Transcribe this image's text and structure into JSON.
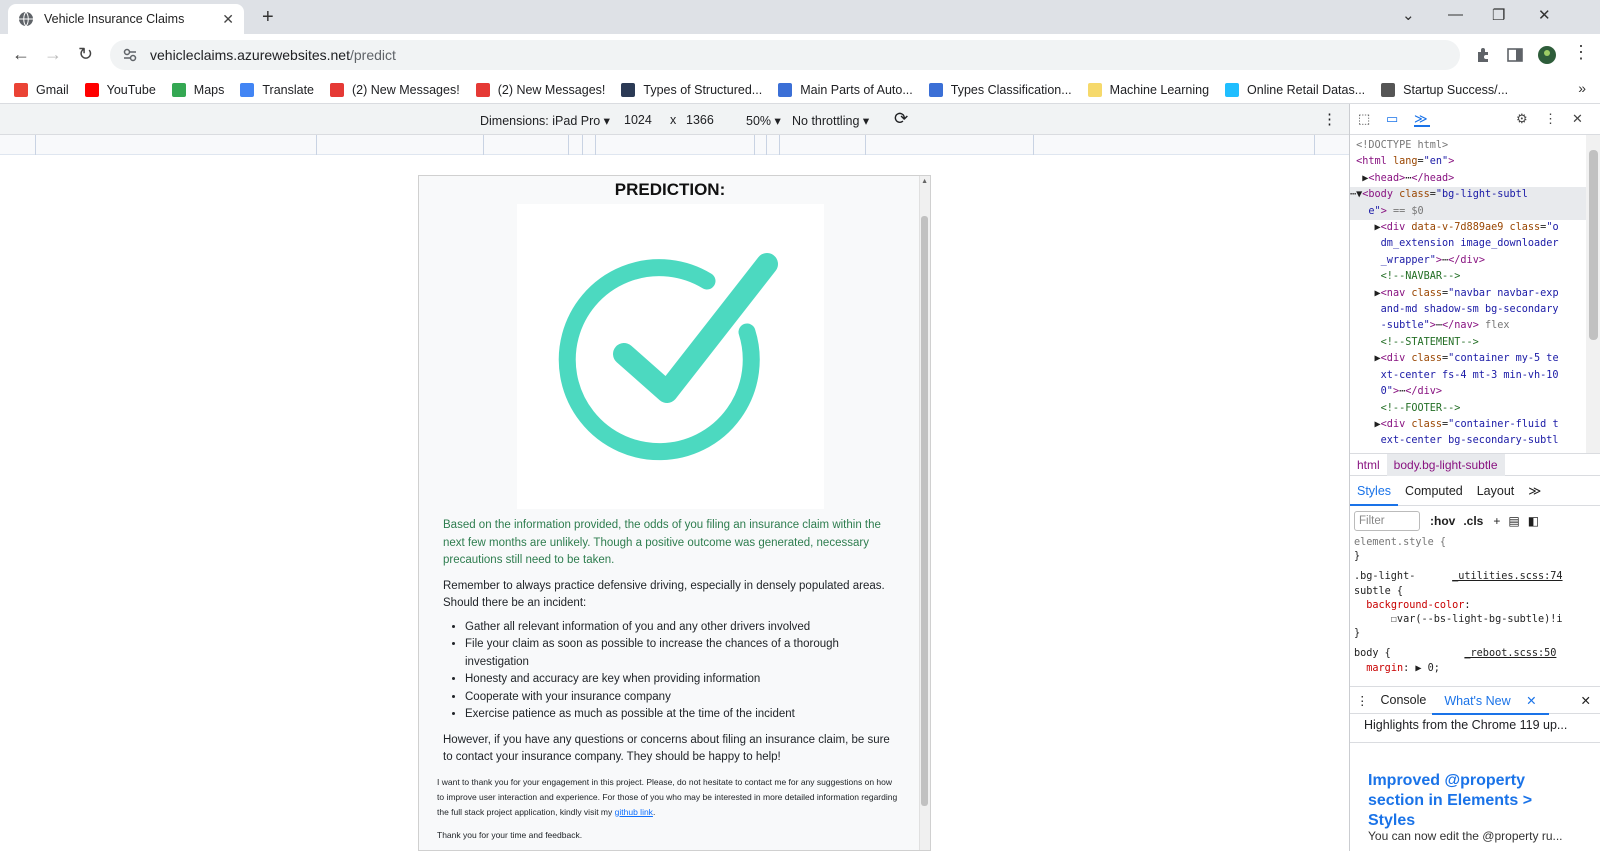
{
  "browser": {
    "tab_title": "Vehicle Insurance Claims",
    "url_host": "vehicleclaims.azurewebsites.net",
    "url_path": "/predict",
    "bookmarks": [
      {
        "label": "Gmail",
        "icon": "gmail-icon",
        "color": "#ea4335"
      },
      {
        "label": "YouTube",
        "icon": "youtube-icon",
        "color": "#ff0000"
      },
      {
        "label": "Maps",
        "icon": "maps-icon",
        "color": "#34a853"
      },
      {
        "label": "Translate",
        "icon": "translate-icon",
        "color": "#4285f4"
      },
      {
        "label": "(2) New Messages!",
        "icon": "messages-icon",
        "color": "#e53935"
      },
      {
        "label": "(2) New Messages!",
        "icon": "messages-icon",
        "color": "#e53935"
      },
      {
        "label": "Types of Structured...",
        "icon": "tds-icon",
        "color": "#2b3a55"
      },
      {
        "label": "Main Parts of Auto...",
        "icon": "medium-icon",
        "color": "#3b6fd6"
      },
      {
        "label": "Types Classification...",
        "icon": "medium-icon",
        "color": "#3b6fd6"
      },
      {
        "label": "Machine Learning",
        "icon": "folder-icon",
        "color": "#f6d96b"
      },
      {
        "label": "Online Retail Datas...",
        "icon": "kaggle-icon",
        "color": "#20beff"
      },
      {
        "label": "Startup Success/...",
        "icon": "rocket-icon",
        "color": "#555555"
      }
    ]
  },
  "device_toolbar": {
    "dimensions_label": "Dimensions: iPad Pro",
    "width": "1024",
    "times": "x",
    "height": "1366",
    "zoom": "50%",
    "throttling": "No throttling"
  },
  "page": {
    "heading": "PREDICTION:",
    "check_color": "#4cd9c0",
    "result_text": "Based on the information provided, the odds of you filing an insurance claim within the next few months are unlikely. Though a positive outcome was generated, necessary precautions still need to be taken.",
    "reminder_text": "Remember to always practice defensive driving, especially in densely populated areas. Should there be an incident:",
    "tips": [
      "Gather all relevant information of you and any other drivers involved",
      "File your claim as soon as possible to increase the chances of a thorough investigation",
      "Honesty and accuracy are key when providing information",
      "Cooperate with your insurance company",
      "Exercise patience as much as possible at the time of the incident"
    ],
    "questions_text": "However, if you have any questions or concerns about filing an insurance claim, be sure to contact your insurance company. They should be happy to help!",
    "thanks_text": "I want to thank you for your engagement in this project. Please, do not hesitate to contact me for any suggestions on how to improve user interaction and experience. For those of you who may be interested in more detailed information regarding the full stack project application, kindly visit my",
    "github_link": "github link",
    "thanks_end": ".",
    "final_text": "Thank you for your time and feedback."
  },
  "devtools": {
    "breadcrumbs": [
      "html",
      "body.bg-light-subtle"
    ],
    "style_tabs": [
      "Styles",
      "Computed",
      "Layout"
    ],
    "filter_placeholder": "Filter",
    "hov": ":hov",
    "cls": ".cls",
    "drawer_tabs": [
      "Console",
      "What's New"
    ],
    "whats_new_heading": "Highlights from the Chrome 119 up...",
    "whats_new_title": "Improved @property section in Elements > Styles",
    "whats_new_sub": "You can now edit the @property ru..."
  }
}
